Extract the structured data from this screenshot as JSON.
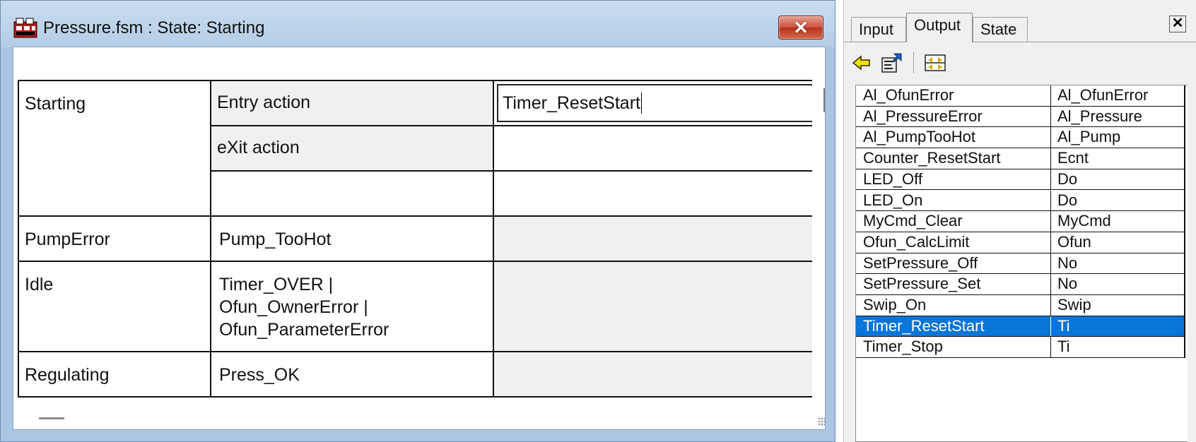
{
  "window": {
    "title": "Pressure.fsm : State: Starting",
    "close_label": "✕"
  },
  "state_table": {
    "rows": [
      {
        "state": "Starting",
        "cells": [
          {
            "label": "Entry action",
            "value": "Timer_ResetStart"
          },
          {
            "label": "eXit action",
            "value": ""
          },
          {
            "label": "",
            "value": ""
          }
        ]
      },
      {
        "state": "PumpError",
        "condition": "Pump_TooHot"
      },
      {
        "state": "Idle",
        "condition_lines": [
          "Timer_OVER |",
          "Ofun_OwnerError |",
          "Ofun_ParameterError"
        ]
      },
      {
        "state": "Regulating",
        "condition": "Press_OK"
      }
    ]
  },
  "panel": {
    "tabs": [
      "Input",
      "Output",
      "State"
    ],
    "active_tab": "Output",
    "close_label": "✕",
    "toolbar": [
      "back-arrow-icon",
      "properties-icon",
      "resize-icon"
    ],
    "outputs": [
      {
        "name": "Al_OfunError",
        "value": "Al_OfunError"
      },
      {
        "name": "Al_PressureError",
        "value": "Al_Pressure"
      },
      {
        "name": "Al_PumpTooHot",
        "value": "Al_Pump"
      },
      {
        "name": "Counter_ResetStart",
        "value": "Ecnt"
      },
      {
        "name": "LED_Off",
        "value": "Do"
      },
      {
        "name": "LED_On",
        "value": "Do"
      },
      {
        "name": "MyCmd_Clear",
        "value": "MyCmd"
      },
      {
        "name": "Ofun_CalcLimit",
        "value": "Ofun"
      },
      {
        "name": "SetPressure_Off",
        "value": "No"
      },
      {
        "name": "SetPressure_Set",
        "value": "No"
      },
      {
        "name": "Swip_On",
        "value": "Swip"
      },
      {
        "name": "Timer_ResetStart",
        "value": "Ti"
      },
      {
        "name": "Timer_Stop",
        "value": "Ti"
      }
    ],
    "selected_output": "Timer_ResetStart",
    "selection_color": "#0a75d8"
  }
}
